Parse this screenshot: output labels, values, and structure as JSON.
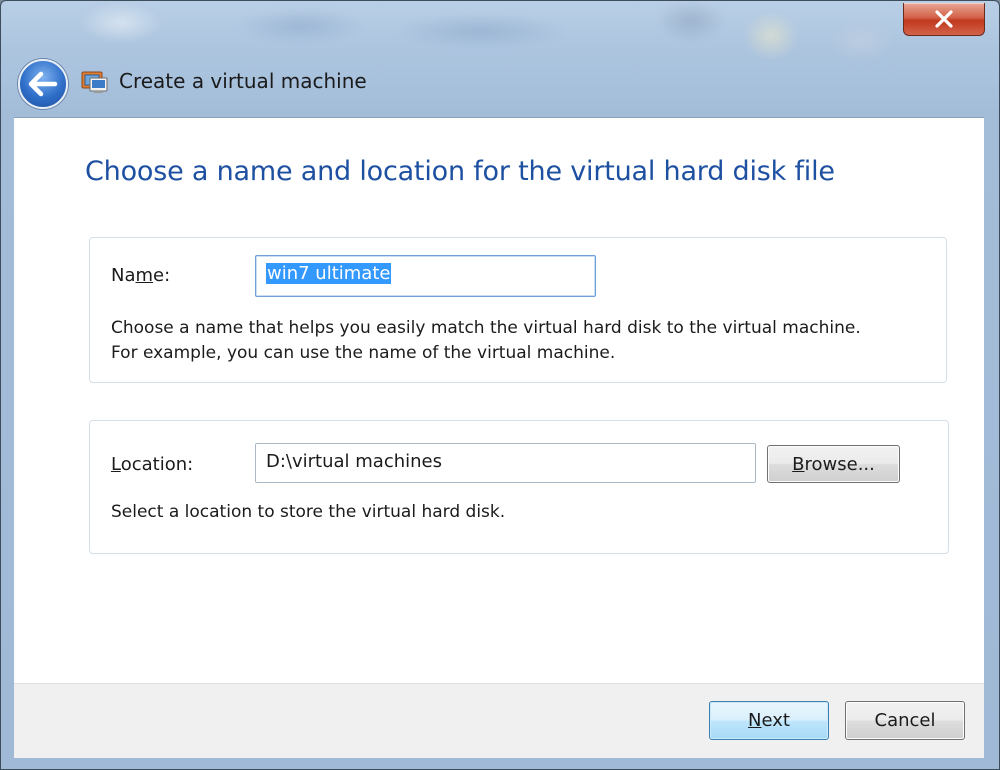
{
  "window": {
    "title": "Create a virtual machine",
    "close_glyph": "✕"
  },
  "page": {
    "heading": "Choose a name and location for the virtual hard disk file"
  },
  "name_group": {
    "label_pre": "Na",
    "label_mnemonic": "m",
    "label_post": "e:",
    "value": "win7 ultimate",
    "description_line1": "Choose a name that helps you easily match the virtual hard disk to the virtual machine.",
    "description_line2": "For example, you can use the name of the virtual machine."
  },
  "location_group": {
    "label_mnemonic": "L",
    "label_post": "ocation:",
    "value": "D:\\virtual machines",
    "browse_mnemonic": "B",
    "browse_post": "rowse...",
    "description": "Select a location to store the virtual hard disk."
  },
  "footer": {
    "next_mnemonic": "N",
    "next_post": "ext",
    "cancel_label": "Cancel"
  },
  "icons": {
    "back": "back-arrow-icon",
    "app": "virtual-machine-icon",
    "close": "close-icon"
  },
  "colors": {
    "heading": "#1e50a2",
    "selection": "#3399ff",
    "close_button": "#c0391d",
    "back_button": "#2f6fc9"
  }
}
